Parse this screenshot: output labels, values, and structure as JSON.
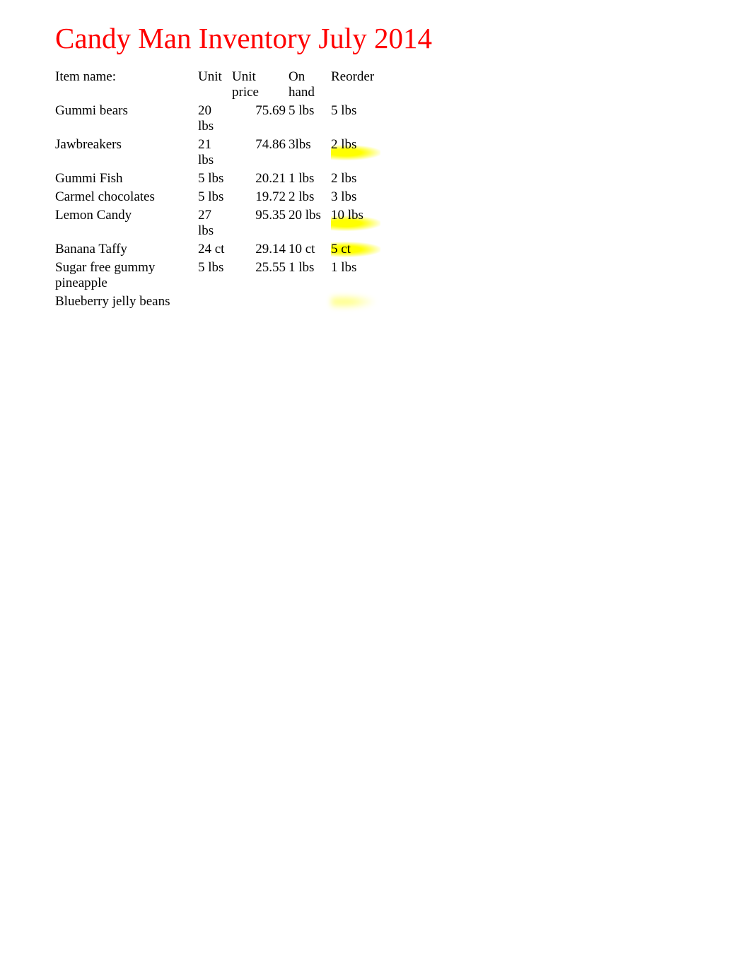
{
  "title": "Candy Man Inventory July 2014",
  "headers": {
    "item": "Item name:",
    "unit": "Unit",
    "price": "Unit price",
    "onhand": "On hand",
    "reorder": "Reorder"
  },
  "rows": [
    {
      "item": "Gummi bears",
      "unit": "20 lbs",
      "price": "75.69",
      "onhand": "5 lbs",
      "reorder": "5 lbs",
      "highlight": false,
      "blurred": false
    },
    {
      "item": "Jawbreakers",
      "unit": "21 lbs",
      "price": "74.86",
      "onhand": "3lbs",
      "reorder": "2 lbs",
      "highlight": true,
      "blurred": false
    },
    {
      "item": "Gummi Fish",
      "unit": "5 lbs",
      "price": "20.21",
      "onhand": "1 lbs",
      "reorder": "2 lbs",
      "highlight": false,
      "blurred": false
    },
    {
      "item": "Carmel chocolates",
      "unit": "5 lbs",
      "price": "19.72",
      "onhand": "2 lbs",
      "reorder": "3 lbs",
      "highlight": false,
      "blurred": false
    },
    {
      "item": "Lemon Candy",
      "unit": "27 lbs",
      "price": "95.35",
      "onhand": "20 lbs",
      "reorder": "10 lbs",
      "highlight": true,
      "blurred": false
    },
    {
      "item": "Banana Taffy",
      "unit": "24 ct",
      "price": "29.14",
      "onhand": "10 ct",
      "reorder": "5 ct",
      "highlight": true,
      "blurred": false
    },
    {
      "item": "Sugar free gummy pineapple",
      "unit": "5 lbs",
      "price": "25.55",
      "onhand": "1 lbs",
      "reorder": "1 lbs",
      "highlight": false,
      "blurred": false
    },
    {
      "item": "Blueberry jelly beans",
      "unit": "",
      "price": "",
      "onhand": "",
      "reorder": "",
      "highlight": true,
      "blurred": true
    }
  ]
}
